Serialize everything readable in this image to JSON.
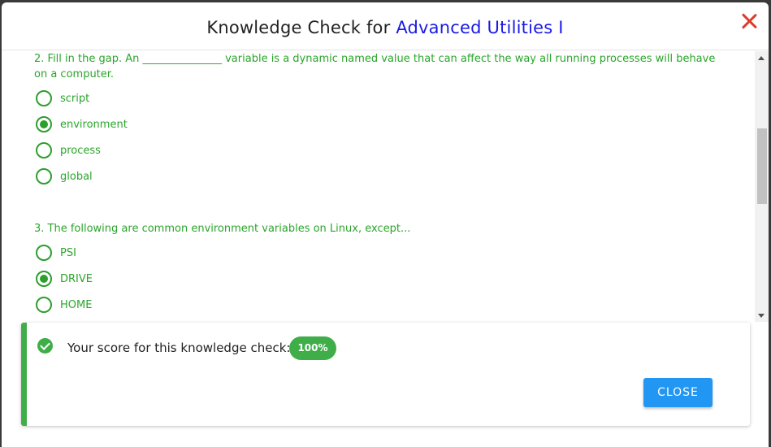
{
  "dialog": {
    "title_prefix": "Knowledge Check for",
    "title_course": "Advanced Utilities I"
  },
  "questions": [
    {
      "text": "2. Fill in the gap. An _______________ variable is a dynamic named value that can affect the way all running processes will behave on a computer.",
      "options": [
        {
          "label": "script",
          "selected": false
        },
        {
          "label": "environment",
          "selected": true
        },
        {
          "label": "process",
          "selected": false
        },
        {
          "label": "global",
          "selected": false
        }
      ]
    },
    {
      "text": "3. The following are common environment variables on Linux, except...",
      "options": [
        {
          "label": "PSI",
          "selected": false
        },
        {
          "label": "DRIVE",
          "selected": true
        },
        {
          "label": "HOME",
          "selected": false
        }
      ]
    }
  ],
  "result": {
    "score_label": "Your score for this knowledge check:",
    "score_value": "100%",
    "close_label": "CLOSE"
  },
  "colors": {
    "accent_green": "#3fae49",
    "question_text": "#2aa52a",
    "title_link": "#1a1ae6",
    "close_x": "#e03a2a",
    "button_blue": "#2196f3"
  }
}
